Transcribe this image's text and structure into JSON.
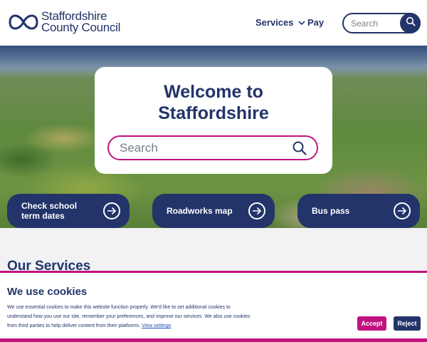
{
  "brand": {
    "name_line1": "Staffordshire",
    "name_line2": "County Council",
    "logo_icon": "stafford-knot-icon",
    "color_primary": "#223469",
    "color_accent": "#c0137f"
  },
  "header": {
    "nav": {
      "services_label": "Services",
      "pay_label": "Pay"
    },
    "search": {
      "placeholder": "Search",
      "button_icon": "search-icon"
    }
  },
  "hero": {
    "title_line1": "Welcome to",
    "title_line2": "Staffordshire",
    "search": {
      "placeholder": "Search",
      "icon": "search-icon"
    }
  },
  "quick_links": [
    {
      "label": "Check school\nterm dates",
      "icon": "arrow-right-circle-icon"
    },
    {
      "label": "Roadworks map",
      "icon": "arrow-right-circle-icon"
    },
    {
      "label": "Bus pass",
      "icon": "arrow-right-circle-icon"
    }
  ],
  "main": {
    "services_heading": "Our Services"
  },
  "cookies": {
    "title": "We use cookies",
    "text": "We use essential cookies to make this website function properly. We'd like to set additional cookies to understand how you use our site, remember your preferences, and improve our services. We also use cookies from third parties to help deliver content from their platforms.",
    "link_label": "View settings",
    "accept_label": "Accept",
    "reject_label": "Reject"
  }
}
